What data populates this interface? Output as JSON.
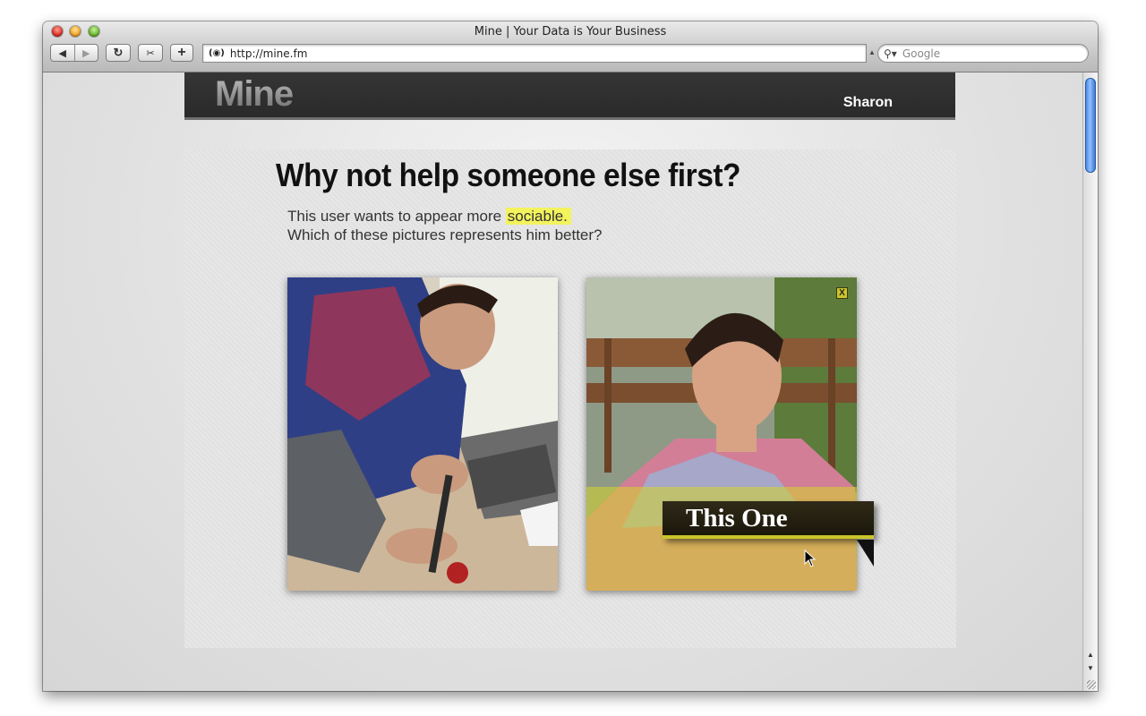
{
  "window": {
    "title": "Mine | Your Data is Your Business"
  },
  "toolbar": {
    "back_icon": "back-arrow-icon",
    "forward_icon": "forward-arrow-icon",
    "reload_icon": "reload-icon",
    "snippet_icon": "scissors-icon",
    "add_icon": "plus-icon",
    "url": "http://mine.fm",
    "search_placeholder": "Google"
  },
  "site": {
    "logo": "Mine",
    "user_name": "Sharon"
  },
  "prompt": {
    "headline": "Why not help someone else first?",
    "line1_prefix": "This user wants to appear more",
    "line1_highlight": "sociable.",
    "line2": "Which of these pictures represents him better?"
  },
  "choices": {
    "close_label": "X",
    "selected_label": "This One"
  },
  "colors": {
    "accent_yellow": "#c9c52b",
    "highlight": "#f3f35e",
    "header_bg": "#2e2e2e",
    "scroll_thumb": "#3b7bd8"
  }
}
